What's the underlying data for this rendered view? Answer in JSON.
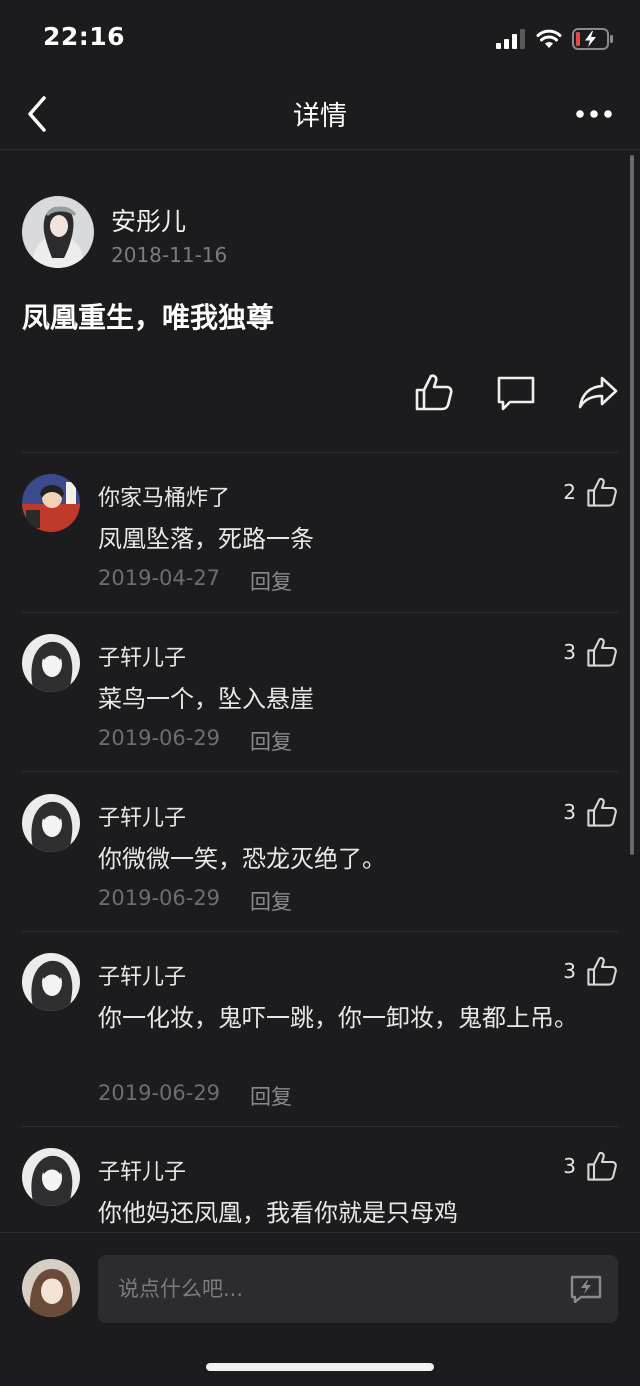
{
  "status": {
    "time": "22:16"
  },
  "nav": {
    "title": "详情"
  },
  "post": {
    "author": "安彤儿",
    "date": "2018-11-16",
    "body": "凤凰重生，唯我独尊"
  },
  "comments": [
    {
      "name": "你家马桶炸了",
      "text": "凤凰坠落，死路一条",
      "date": "2019-04-27",
      "reply": "回复",
      "likes": "2"
    },
    {
      "name": "子轩儿子",
      "text": "菜鸟一个，坠入悬崖",
      "date": "2019-06-29",
      "reply": "回复",
      "likes": "3"
    },
    {
      "name": "子轩儿子",
      "text": "你微微一笑，恐龙灭绝了。",
      "date": "2019-06-29",
      "reply": "回复",
      "likes": "3"
    },
    {
      "name": "子轩儿子",
      "text": "你一化妆，鬼吓一跳，你一卸妆，鬼都上吊。",
      "date": "2019-06-29",
      "reply": "回复",
      "likes": "3"
    },
    {
      "name": "子轩儿子",
      "text": "你他妈还凤凰，我看你就是只母鸡",
      "likes": "3"
    }
  ],
  "input": {
    "placeholder": "说点什么吧..."
  },
  "colors": {
    "background": "#1c1c1e",
    "text": "#e8e8e8",
    "muted": "#6e6e72",
    "battery_low": "#e5484d"
  }
}
